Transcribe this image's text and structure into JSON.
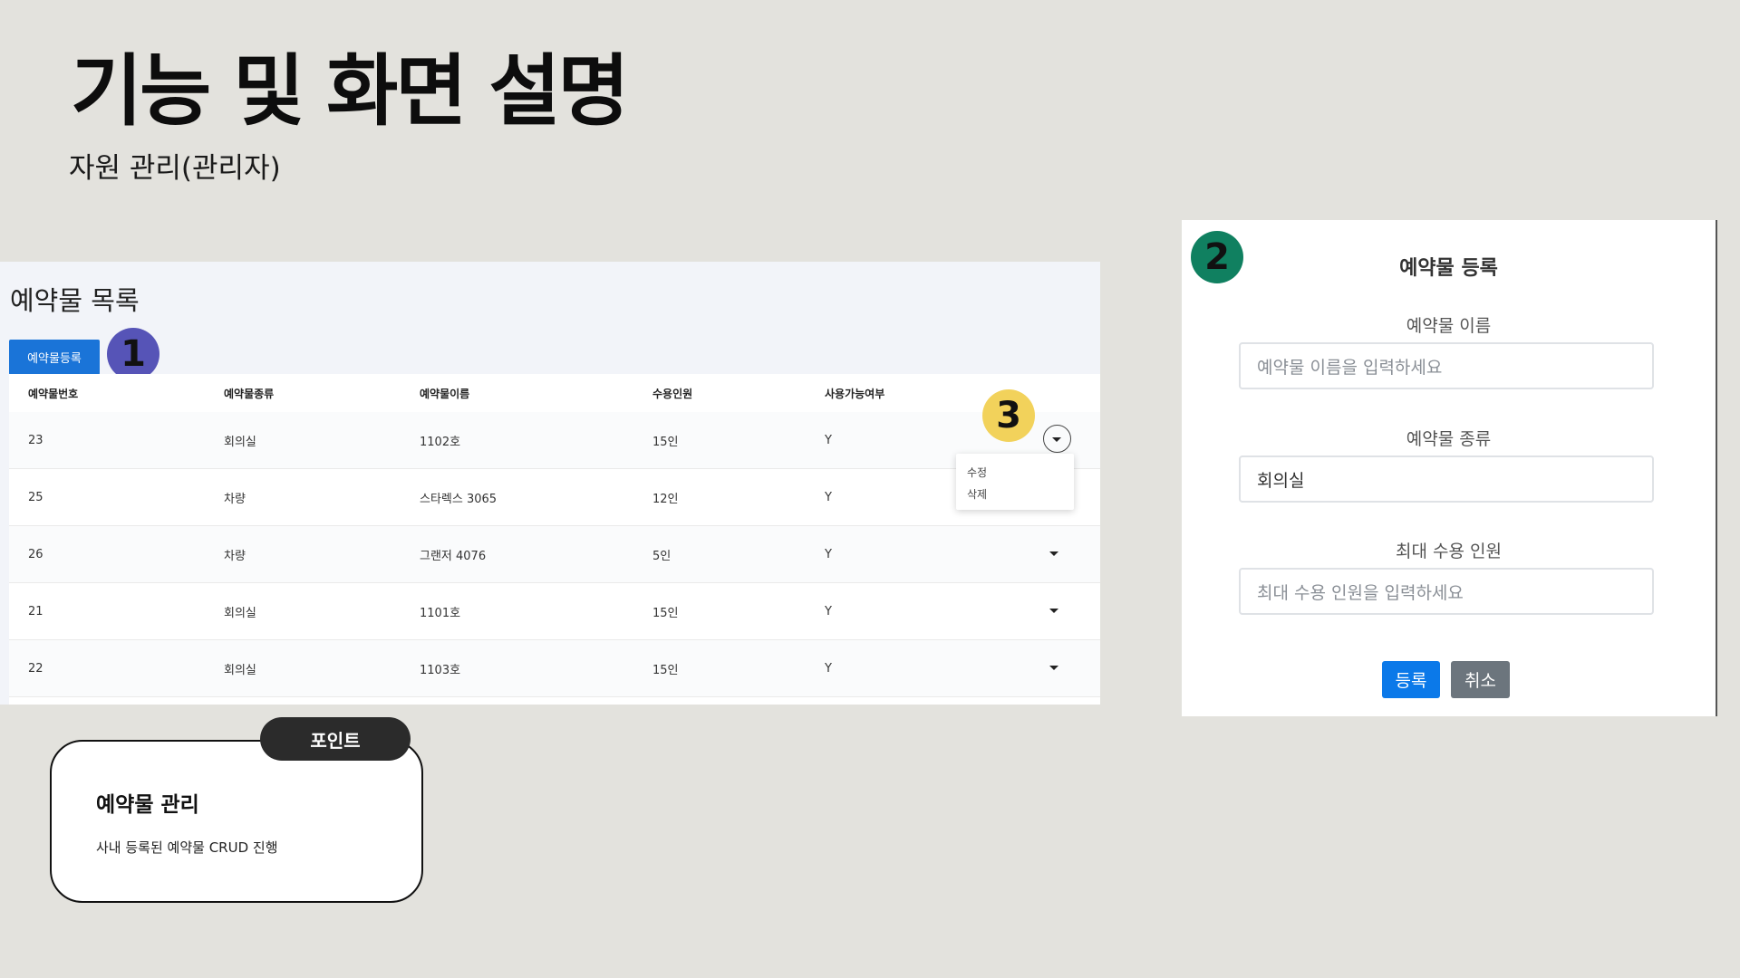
{
  "slide": {
    "title": "기능 및 화면 설명",
    "subtitle": "자원 관리(관리자)"
  },
  "list": {
    "title": "예약물 목록",
    "register_button": "예약물등록",
    "columns": [
      "예약물번호",
      "예약물종류",
      "예약물이름",
      "수용인원",
      "사용가능여부"
    ],
    "rows": [
      {
        "id": "23",
        "type": "회의실",
        "name": "1102호",
        "capacity": "15인",
        "available": "Y"
      },
      {
        "id": "25",
        "type": "차량",
        "name": "스타렉스 3065",
        "capacity": "12인",
        "available": "Y"
      },
      {
        "id": "26",
        "type": "차량",
        "name": "그랜저 4076",
        "capacity": "5인",
        "available": "Y"
      },
      {
        "id": "21",
        "type": "회의실",
        "name": "1101호",
        "capacity": "15인",
        "available": "Y"
      },
      {
        "id": "22",
        "type": "회의실",
        "name": "1103호",
        "capacity": "15인",
        "available": "Y"
      }
    ],
    "dropdown_items": [
      "수정",
      "삭제"
    ]
  },
  "badges": {
    "one": "1",
    "two": "2",
    "three": "3"
  },
  "modal": {
    "title": "예약물 등록",
    "name_label": "예약물 이름",
    "name_placeholder": "예약물 이름을 입력하세요",
    "type_label": "예약물 종류",
    "type_value": "회의실",
    "capacity_label": "최대 수용 인원",
    "capacity_placeholder": "최대 수용 인원을 입력하세요",
    "submit_label": "등록",
    "cancel_label": "취소"
  },
  "point": {
    "tag": "포인트",
    "heading": "예약물 관리",
    "description": "사내 등록된 예약물 CRUD 진행"
  },
  "colors": {
    "background": "#e3e2dd",
    "primary_button": "#1a74d8",
    "badge_1": "#5654b7",
    "badge_2": "#108060",
    "badge_3": "#f2d25b",
    "cancel_button": "#6c757d"
  }
}
